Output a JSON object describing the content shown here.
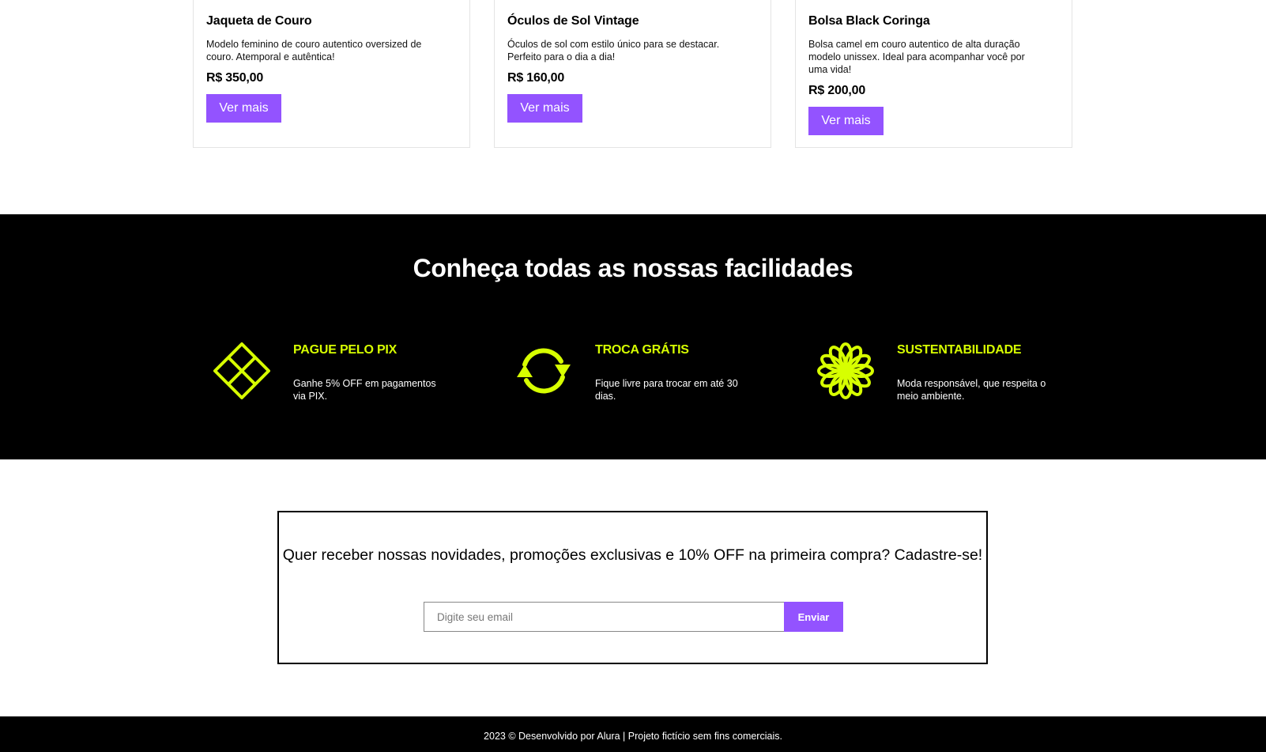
{
  "products": [
    {
      "title": "Jaqueta de Couro",
      "description": "Modelo feminino de couro autentico oversized de couro. Atemporal e autêntica!",
      "price": "R$ 350,00",
      "button_label": "Ver mais"
    },
    {
      "title": "Óculos de Sol Vintage",
      "description": "Óculos de sol com estilo único para se destacar. Perfeito para o dia a dia!",
      "price": "R$ 160,00",
      "button_label": "Ver mais"
    },
    {
      "title": "Bolsa Black Coringa",
      "description": "Bolsa camel em couro autentico de alta duração modelo unissex. Ideal para acompanhar você por uma vida!",
      "price": "R$ 200,00",
      "button_label": "Ver mais"
    }
  ],
  "features": {
    "title": "Conheça todas as nossas facilidades",
    "items": [
      {
        "icon": "pix-icon",
        "title": "PAGUE PELO PIX",
        "text": "Ganhe 5% OFF em pagamentos via PIX."
      },
      {
        "icon": "exchange-icon",
        "title": "TROCA GRÁTIS",
        "text": "Fique livre para trocar em até 30 dias."
      },
      {
        "icon": "flower-icon",
        "title": "SUSTENTABILIDADE",
        "text": "Moda responsável, que respeita o meio ambiente."
      }
    ]
  },
  "newsletter": {
    "text": "Quer receber nossas novidades, promoções exclusivas e 10% OFF na primeira compra? Cadastre-se!",
    "placeholder": "Digite seu email",
    "button_label": "Enviar"
  },
  "footer": {
    "text": "2023 © Desenvolvido por Alura | Projeto fictício sem fins comerciais."
  },
  "colors": {
    "accent": "#9353ff",
    "highlight": "#d7ff00",
    "dark": "#000000"
  }
}
